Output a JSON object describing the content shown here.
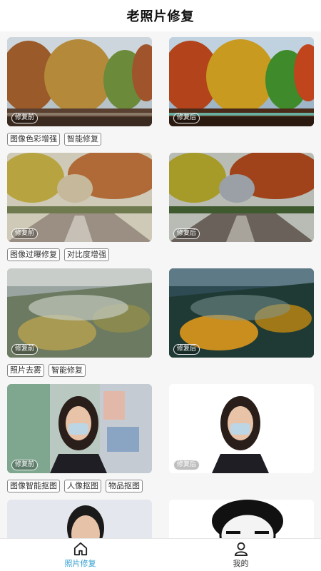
{
  "header": {
    "title": "老照片修复"
  },
  "cards": [
    {
      "before_label": "修复前",
      "after_label": "修复后",
      "tags": [
        "图像色彩增强",
        "智能修复"
      ]
    },
    {
      "before_label": "修复前",
      "after_label": "修复后",
      "tags": [
        "图像过曝修复",
        "对比度增强"
      ]
    },
    {
      "before_label": "修复前",
      "after_label": "修复后",
      "tags": [
        "照片去雾",
        "智能修复"
      ]
    },
    {
      "before_label": "修复前",
      "after_label": "修复后",
      "tags": [
        "图像智能抠图",
        "人像抠图",
        "物品抠图"
      ]
    }
  ],
  "tabbar": {
    "items": [
      {
        "label": "照片修复",
        "icon": "home-icon",
        "active": true
      },
      {
        "label": "我的",
        "icon": "user-icon",
        "active": false
      }
    ]
  },
  "colors": {
    "accent": "#2e9ccf",
    "background": "#f6f6f6"
  }
}
